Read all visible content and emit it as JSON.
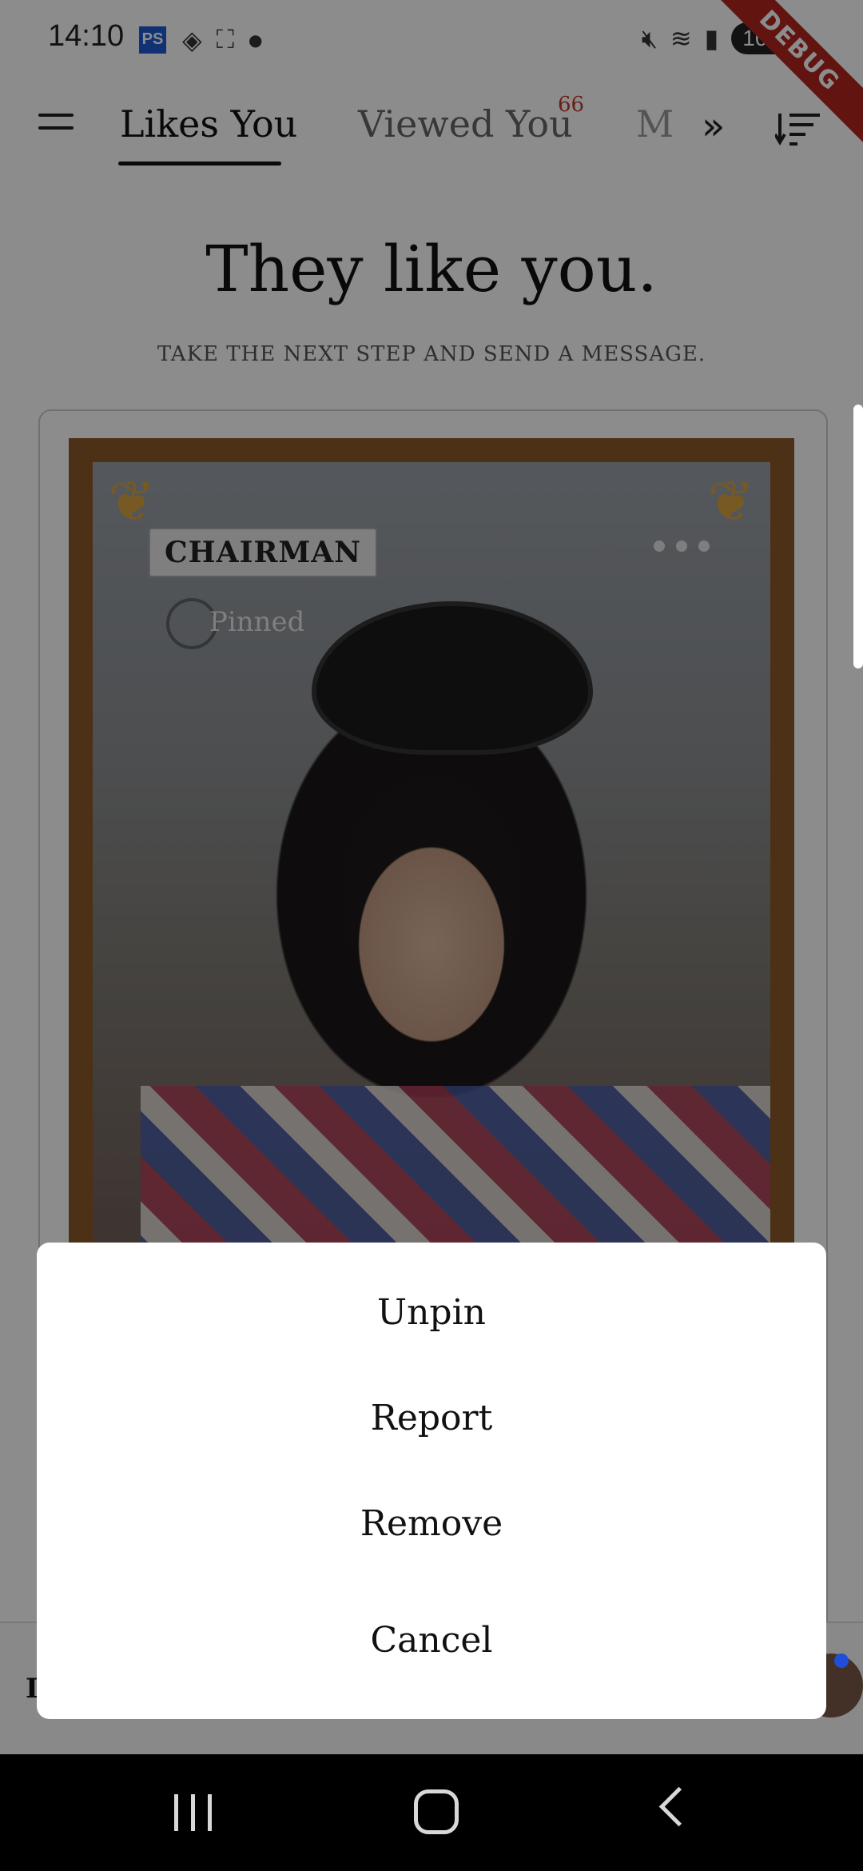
{
  "status_bar": {
    "time": "14:10",
    "left_icons": [
      "ps-app-icon",
      "diamond-icon",
      "screenshot-icon",
      "dot-icon"
    ],
    "ps_label": "PS",
    "right_icons": [
      "mute-icon",
      "wifi-icon",
      "signal-icon"
    ],
    "battery": "100",
    "debug_ribbon": "DEBUG"
  },
  "tabs": {
    "likes_you": "Likes You",
    "viewed_you": "Viewed You",
    "viewed_badge": "66",
    "truncated_next": "M"
  },
  "header": {
    "title": "They like you.",
    "subtitle": "TAKE THE NEXT STEP AND SEND A MESSAGE."
  },
  "profile_card": {
    "badge": "CHAIRMAN",
    "pinned": "Pinned"
  },
  "action_sheet": {
    "items": [
      "Unpin",
      "Report",
      "Remove"
    ],
    "cancel": "Cancel"
  },
  "bottom_bar": {
    "partial_letter": "I"
  },
  "colors": {
    "badge_red": "#c0392b",
    "debug_red": "#b3261e",
    "notification_blue": "#1f4fd6",
    "frame_gold": "#d9a441"
  }
}
